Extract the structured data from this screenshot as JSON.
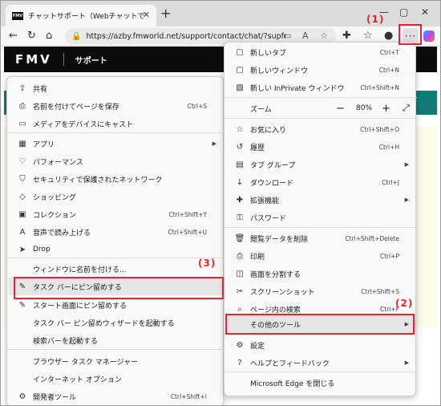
{
  "browser": {
    "tab_title": "チャットサポート（Webチャットで相談）",
    "tab_favicon": "FMV",
    "url": "https://azby.fmworld.net/support/contact/chat/?supfro..."
  },
  "page": {
    "logo": "FMV",
    "section": "サポート"
  },
  "left_menu": [
    {
      "icon": "share-icon",
      "glyph": "⇪",
      "label": "共有",
      "shortcut": ""
    },
    {
      "icon": "save-page-icon",
      "glyph": "⎙",
      "label": "名前を付けてページを保存",
      "shortcut": "Ctrl+S"
    },
    {
      "icon": "cast-icon",
      "glyph": "▭",
      "label": "メディアをデバイスにキャスト",
      "shortcut": ""
    },
    {
      "icon": "apps-icon",
      "glyph": "▦",
      "label": "アプリ",
      "shortcut": "",
      "submenu": true
    },
    {
      "icon": "performance-icon",
      "glyph": "♡",
      "label": "パフォーマンス",
      "shortcut": ""
    },
    {
      "icon": "secure-network-icon",
      "glyph": "⛉",
      "label": "セキュリティで保護されたネットワーク",
      "shortcut": ""
    },
    {
      "icon": "shopping-icon",
      "glyph": "◇",
      "label": "ショッピング",
      "shortcut": ""
    },
    {
      "icon": "collections-icon",
      "glyph": "▣",
      "label": "コレクション",
      "shortcut": "Ctrl+Shift+Y"
    },
    {
      "icon": "read-aloud-icon",
      "glyph": "A",
      "label": "音声で読み上げる",
      "shortcut": "Ctrl+Shift+U"
    },
    {
      "icon": "drop-icon",
      "glyph": "➤",
      "label": "Drop",
      "shortcut": ""
    },
    {
      "icon": "",
      "glyph": "",
      "label": "ウィンドウに名前を付ける...",
      "shortcut": ""
    },
    {
      "icon": "pin-icon",
      "glyph": "✎",
      "label": "タスク バーにピン留めする",
      "shortcut": ""
    },
    {
      "icon": "pin-start-icon",
      "glyph": "✎",
      "label": "スタート画面にピン留めする",
      "shortcut": ""
    },
    {
      "icon": "",
      "glyph": "",
      "label": "タスク バー ピン留めウィザードを起動する",
      "shortcut": ""
    },
    {
      "icon": "",
      "glyph": "",
      "label": "検索バーを起動する",
      "shortcut": ""
    },
    {
      "icon": "",
      "glyph": "",
      "label": "ブラウザー タスク マネージャー",
      "shortcut": ""
    },
    {
      "icon": "",
      "glyph": "",
      "label": "インターネット オプション",
      "shortcut": ""
    },
    {
      "icon": "devtools-icon",
      "glyph": "⚙",
      "label": "開発者ツール",
      "shortcut": "Ctrl+Shift+I"
    }
  ],
  "right_menu": [
    {
      "icon": "new-tab-icon",
      "glyph": "▢",
      "label": "新しいタブ",
      "shortcut": "Ctrl+T"
    },
    {
      "icon": "new-window-icon",
      "glyph": "▢",
      "label": "新しいウィンドウ",
      "shortcut": "Ctrl+N"
    },
    {
      "icon": "inprivate-icon",
      "glyph": "▧",
      "label": "新しい InPrivate ウィンドウ",
      "shortcut": "Ctrl+Shift+N"
    },
    {
      "icon": "",
      "glyph": "",
      "label": "ズーム",
      "shortcut": ""
    },
    {
      "icon": "favorites-icon",
      "glyph": "☆",
      "label": "お気に入り",
      "shortcut": "Ctrl+Shift+O"
    },
    {
      "icon": "history-icon",
      "glyph": "↺",
      "label": "履歴",
      "shortcut": "Ctrl+H"
    },
    {
      "icon": "tab-groups-icon",
      "glyph": "▤",
      "label": "タブ グループ",
      "shortcut": "",
      "submenu": true
    },
    {
      "icon": "download-icon",
      "glyph": "↓",
      "label": "ダウンロード",
      "shortcut": "Ctrl+J"
    },
    {
      "icon": "extensions-icon",
      "glyph": "✚",
      "label": "拡張機能",
      "shortcut": "",
      "submenu": true
    },
    {
      "icon": "password-icon",
      "glyph": "⚿",
      "label": "パスワード",
      "shortcut": ""
    },
    {
      "icon": "delete-browsing-data-icon",
      "glyph": "🗑",
      "label": "閲覧データを削除",
      "shortcut": "Ctrl+Shift+Delete"
    },
    {
      "icon": "print-icon",
      "glyph": "⎙",
      "label": "印刷",
      "shortcut": "Ctrl+P"
    },
    {
      "icon": "split-screen-icon",
      "glyph": "◫",
      "label": "画面を分割する",
      "shortcut": ""
    },
    {
      "icon": "screenshot-icon",
      "glyph": "✂",
      "label": "スクリーンショット",
      "shortcut": "Ctrl+Shift+S"
    },
    {
      "icon": "find-icon",
      "glyph": "⌕",
      "label": "ページ内の検索",
      "shortcut": "Ctrl+F"
    },
    {
      "icon": "",
      "glyph": "",
      "label": "その他のツール",
      "shortcut": "",
      "submenu": true
    },
    {
      "icon": "settings-icon",
      "glyph": "⚙",
      "label": "設定",
      "shortcut": ""
    },
    {
      "icon": "help-icon",
      "glyph": "?",
      "label": "ヘルプとフィードバック",
      "shortcut": "",
      "submenu": true
    },
    {
      "icon": "",
      "glyph": "",
      "label": "Microsoft Edge を閉じる",
      "shortcut": ""
    }
  ],
  "zoom": {
    "value": "80%",
    "minus": "−",
    "plus": "+"
  },
  "callouts": {
    "one": "(1)",
    "two": "(2)",
    "three": "(3)"
  },
  "colors": {
    "annotation_red": "#e0282c",
    "fmv_bar": "#0b0b0b",
    "teal": "#117a76"
  }
}
